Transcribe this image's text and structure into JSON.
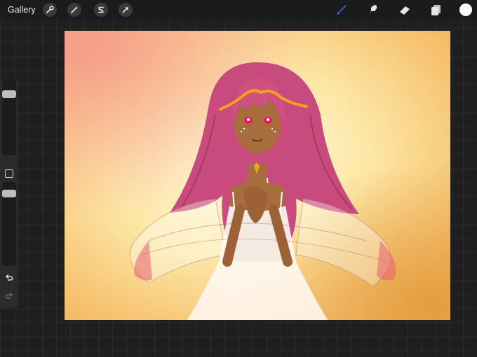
{
  "topbar": {
    "gallery_label": "Gallery",
    "left_tools": [
      "wrench-icon",
      "magic-wand-icon",
      "selection-s-icon",
      "transform-arrow-icon"
    ],
    "right_tools": [
      "brush-icon",
      "smudge-icon",
      "eraser-icon",
      "layers-icon"
    ],
    "active_tool": "brush",
    "accent_color": "#2f7bff",
    "current_color": "#ffffff"
  },
  "sidebar": {
    "brush_size_level": 0.85,
    "opacity_level": 1.0
  },
  "canvas": {
    "background_colors": [
      "#f59a8c",
      "#fde7a6",
      "#f3b35a"
    ]
  }
}
